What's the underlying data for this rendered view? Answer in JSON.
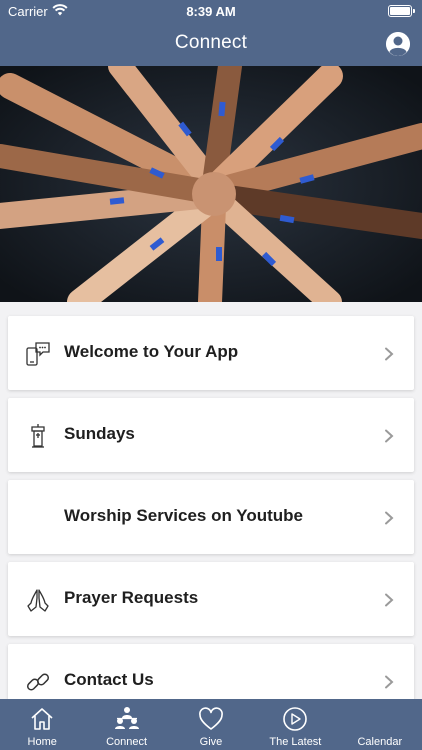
{
  "status_bar": {
    "carrier": "Carrier",
    "time": "8:39 AM"
  },
  "nav": {
    "title": "Connect"
  },
  "hero": {
    "description": "hands-together-photo"
  },
  "menu": [
    {
      "label": "Welcome to Your App",
      "icon": "phone-chat-icon"
    },
    {
      "label": "Sundays",
      "icon": "pulpit-icon"
    },
    {
      "label": "Worship Services on Youtube",
      "icon": ""
    },
    {
      "label": "Prayer Requests",
      "icon": "praying-hands-icon"
    },
    {
      "label": "Contact Us",
      "icon": "link-icon"
    }
  ],
  "tabs": [
    {
      "label": "Home",
      "icon": "home-icon",
      "active": false
    },
    {
      "label": "Connect",
      "icon": "people-icon",
      "active": true
    },
    {
      "label": "Give",
      "icon": "heart-icon",
      "active": false
    },
    {
      "label": "The Latest",
      "icon": "play-circle-icon",
      "active": false
    },
    {
      "label": "Calendar",
      "icon": "calendar-icon",
      "active": false
    }
  ],
  "colors": {
    "header_bg": "#51678a",
    "tabbar_bg": "#51678a",
    "page_bg": "#f2f2f4"
  }
}
